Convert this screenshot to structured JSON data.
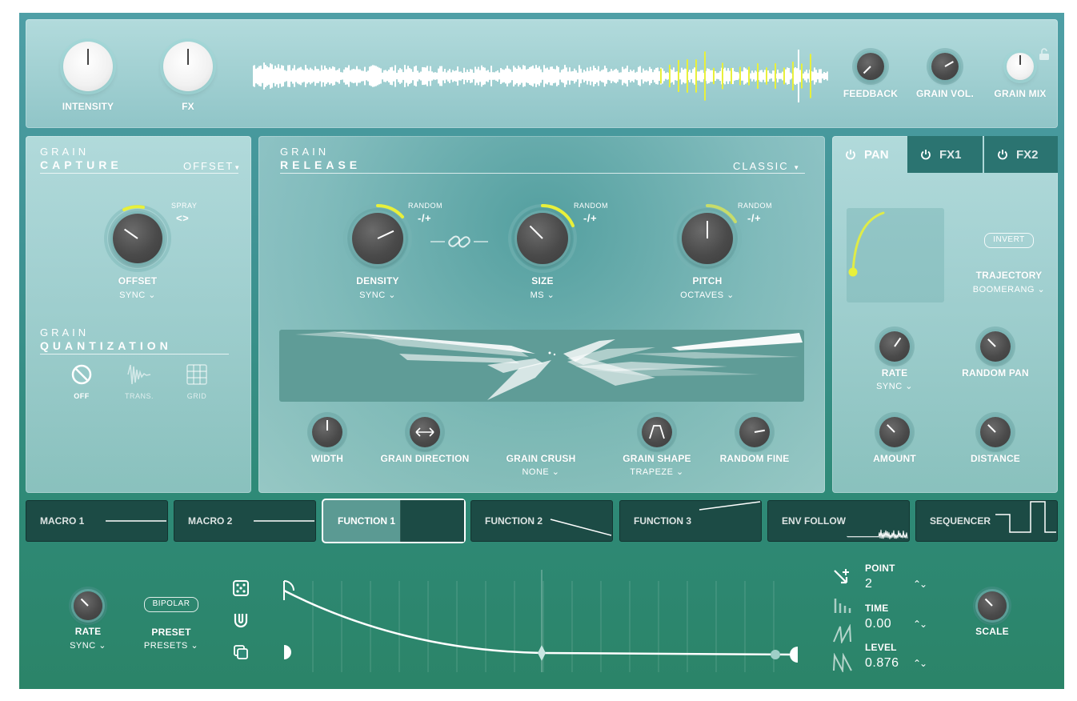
{
  "top": {
    "knobs": [
      {
        "label": "INTENSITY"
      },
      {
        "label": "FX"
      },
      {
        "label": "FEEDBACK"
      },
      {
        "label": "GRAIN VOL."
      },
      {
        "label": "GRAIN MIX"
      }
    ]
  },
  "capture": {
    "title_top": "GRAIN",
    "title_bottom": "CAPTURE",
    "mode": "OFFSET",
    "spray_label": "SPRAY",
    "spray_symbol": "<>",
    "knob_label": "OFFSET",
    "knob_sub": "SYNC",
    "quant_top": "GRAIN",
    "quant_bottom": "QUANTIZATION",
    "quant_options": [
      {
        "label": "OFF",
        "icon": "no-entry-icon"
      },
      {
        "label": "TRANS.",
        "icon": "transient-icon"
      },
      {
        "label": "GRID",
        "icon": "grid-icon"
      }
    ]
  },
  "release": {
    "title_top": "GRAIN",
    "title_bottom": "RELEASE",
    "mode": "CLASSIC",
    "random_label": "RANDOM",
    "random_symbol": "-/+",
    "knobs": [
      {
        "label": "DENSITY",
        "sub": "SYNC"
      },
      {
        "label": "SIZE",
        "sub": "MS"
      },
      {
        "label": "PITCH",
        "sub": "OCTAVES"
      }
    ],
    "bottom": [
      {
        "label": "WIDTH",
        "sub": ""
      },
      {
        "label": "GRAIN DIRECTION",
        "sub": ""
      },
      {
        "label": "GRAIN CRUSH",
        "sub": "NONE"
      },
      {
        "label": "GRAIN SHAPE",
        "sub": "TRAPEZE"
      },
      {
        "label": "RANDOM FINE",
        "sub": ""
      }
    ]
  },
  "pan": {
    "tabs": [
      {
        "label": "PAN",
        "icon": "power-icon"
      },
      {
        "label": "FX1",
        "icon": "power-icon"
      },
      {
        "label": "FX2",
        "icon": "power-icon"
      }
    ],
    "invert": "INVERT",
    "trajectory_label": "TRAJECTORY",
    "trajectory_value": "BOOMERANG",
    "knobs": [
      {
        "label": "RATE",
        "sub": "SYNC"
      },
      {
        "label": "RANDOM PAN",
        "sub": ""
      },
      {
        "label": "AMOUNT",
        "sub": ""
      },
      {
        "label": "DISTANCE",
        "sub": ""
      }
    ]
  },
  "modulators": [
    {
      "label": "MACRO 1"
    },
    {
      "label": "MACRO 2"
    },
    {
      "label": "FUNCTION 1"
    },
    {
      "label": "FUNCTION 2"
    },
    {
      "label": "FUNCTION 3"
    },
    {
      "label": "ENV FOLLOW"
    },
    {
      "label": "SEQUENCER"
    }
  ],
  "function_editor": {
    "rate_label": "RATE",
    "rate_sub": "SYNC",
    "bipolar": "BIPOLAR",
    "preset_label": "PRESET",
    "preset_sub": "PRESETS",
    "point_label": "POINT",
    "point_value": "2",
    "time_label": "TIME",
    "time_value": "0.00",
    "level_label": "LEVEL",
    "level_value": "0.876",
    "scale_label": "SCALE",
    "updown_symbol": "⌃⌄"
  },
  "colors": {
    "accent_yellow": "#e8f03a",
    "panel_dark": "#1c4b45",
    "knob_dark": "#4a4a4a"
  }
}
